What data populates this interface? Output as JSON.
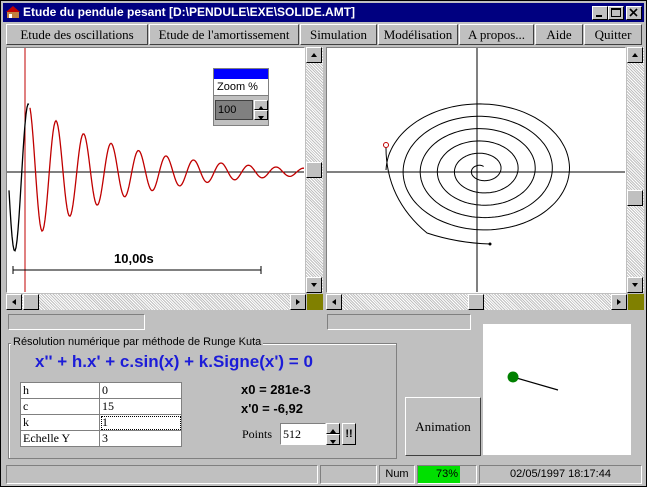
{
  "window": {
    "title": "Etude du pendule pesant [D:\\PENDULE\\EXE\\SOLIDE.AMT]"
  },
  "menu": [
    {
      "label": "Etude des oscillations"
    },
    {
      "label": "Etude de l'amortissement"
    },
    {
      "label": "Simulation"
    },
    {
      "label": "Modélisation"
    },
    {
      "label": "A propos..."
    },
    {
      "label": "Aide"
    },
    {
      "label": "Quitter"
    }
  ],
  "zoom": {
    "label": "Zoom %",
    "value": "100"
  },
  "left_plot": {
    "duration_label": "10,00s"
  },
  "group": {
    "title": "Résolution numérique par méthode de Runge Kuta",
    "equation": "x'' + h.x' + c.sin(x) + k.Signe(x') = 0"
  },
  "params": [
    {
      "name": "h",
      "value": "0"
    },
    {
      "name": "c",
      "value": "15"
    },
    {
      "name": "k",
      "value": "1"
    },
    {
      "name": "Echelle Y",
      "value": "3"
    }
  ],
  "results": {
    "x0": "x0 = 281e-3",
    "xp0": "x'0 = -6,92"
  },
  "points": {
    "label": "Points",
    "value": "512",
    "go_label": "!!"
  },
  "animation": {
    "label": "Animation"
  },
  "status": {
    "num": "Num",
    "progress_text": "73%",
    "progress_value": 0.73,
    "datetime": "02/05/1997 18:17:44"
  },
  "colors": {
    "title_bar": "#000080",
    "curve": "#c00000",
    "equation": "#1c1cd8",
    "progress": "#00e000",
    "pendulum_bob": "#008000"
  }
}
